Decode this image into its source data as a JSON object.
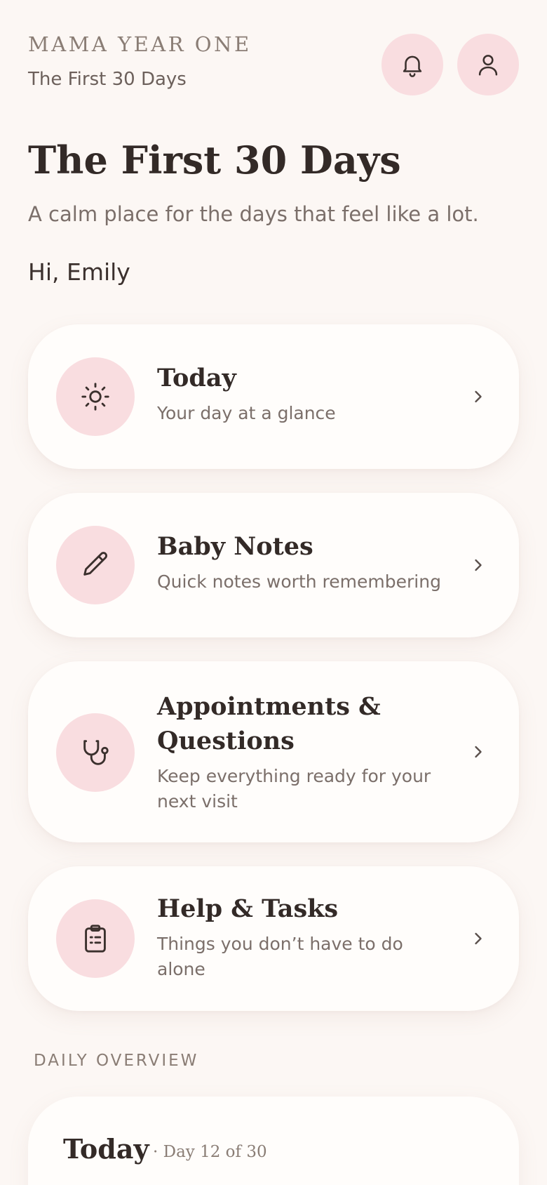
{
  "header": {
    "brand": "MAMA YEAR ONE",
    "subtitle": "The First 30 Days",
    "notifications_icon": "bell-icon",
    "profile_icon": "user-icon"
  },
  "hero": {
    "title": "The First 30 Days",
    "subtitle": "A calm place for the days that feel like a lot.",
    "greeting": "Hi, Emily"
  },
  "cards": [
    {
      "title": "Today",
      "description": "Your day at a glance",
      "icon": "sun-icon"
    },
    {
      "title": "Baby Notes",
      "description": "Quick notes worth remembering",
      "icon": "pencil-icon"
    },
    {
      "title": "Appointments & Questions",
      "description": "Keep everything ready for your next visit",
      "icon": "stethoscope-icon"
    },
    {
      "title": "Help & Tasks",
      "description": "Things you don’t have to do alone",
      "icon": "clipboard-icon"
    }
  ],
  "daily_overview": {
    "label": "DAILY OVERVIEW",
    "title": "Today",
    "day_text": "· Day 12 of 30"
  },
  "colors": {
    "background": "#fcf7f4",
    "accent_pink": "#f9dde0",
    "card": "#fffdfb",
    "text_dark": "#332a27",
    "text_muted": "#7b6f6a"
  }
}
